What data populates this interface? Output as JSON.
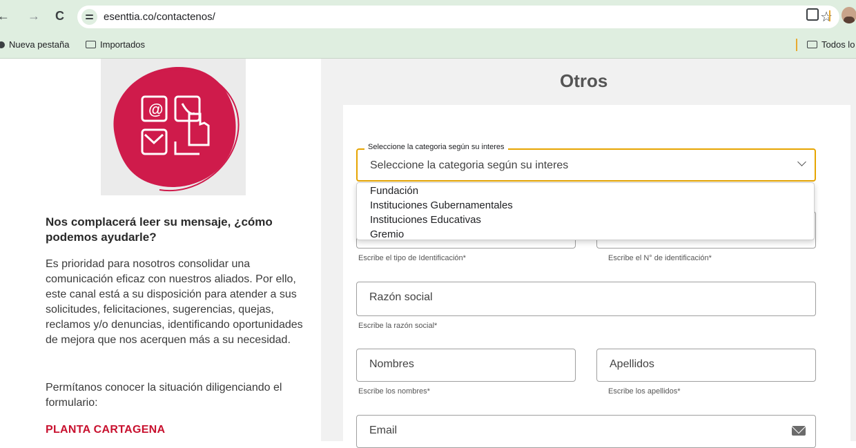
{
  "browser": {
    "back": "←",
    "forward": "→",
    "reload": "C",
    "url": "esenttia.co/contactenos/",
    "star": "☆",
    "bookmarks": [
      {
        "label": "Nueva pestaña"
      },
      {
        "label": "Importados"
      }
    ],
    "all_bookmarks": "Todos lo"
  },
  "left": {
    "image_icon": "contact-channels-illustration",
    "title": "Nos complacerá leer su mensaje, ¿cómo podemos ayudarle?",
    "body": "Es prioridad para nosotros consolidar una comunicación eficaz con nuestros aliados. Por ello, este canal está a su disposición para atender a sus solicitudes, felicitaciones, sugerencias, quejas, reclamos y/o denuncias, identificando oportunidades de mejora que nos acerquen más a su necesidad.",
    "body2": "Permítanos conocer la situación diligenciando el formulario:",
    "plant": "PLANTA CARTAGENA"
  },
  "form": {
    "title": "Otros",
    "category": {
      "legend": "Seleccione la categoria según su interes",
      "value": "Seleccione la categoria según su interes",
      "options": [
        "Fundación",
        "Instituciones Gubernamentales",
        "Instituciones Educativas",
        "Gremio"
      ]
    },
    "id_type_helper": "Escribe el tipo de Identificación*",
    "id_number_helper": "Escribe el N° de identificación*",
    "company": {
      "placeholder": "Razón social",
      "helper": "Escribe la razón social*"
    },
    "first_name": {
      "placeholder": "Nombres",
      "helper": "Escribe los nombres*"
    },
    "last_name": {
      "placeholder": "Apellidos",
      "helper": "Escribe los apellidos*"
    },
    "email": {
      "placeholder": "Email"
    }
  },
  "colors": {
    "accent": "#e6a400",
    "brand": "#c8102e"
  }
}
